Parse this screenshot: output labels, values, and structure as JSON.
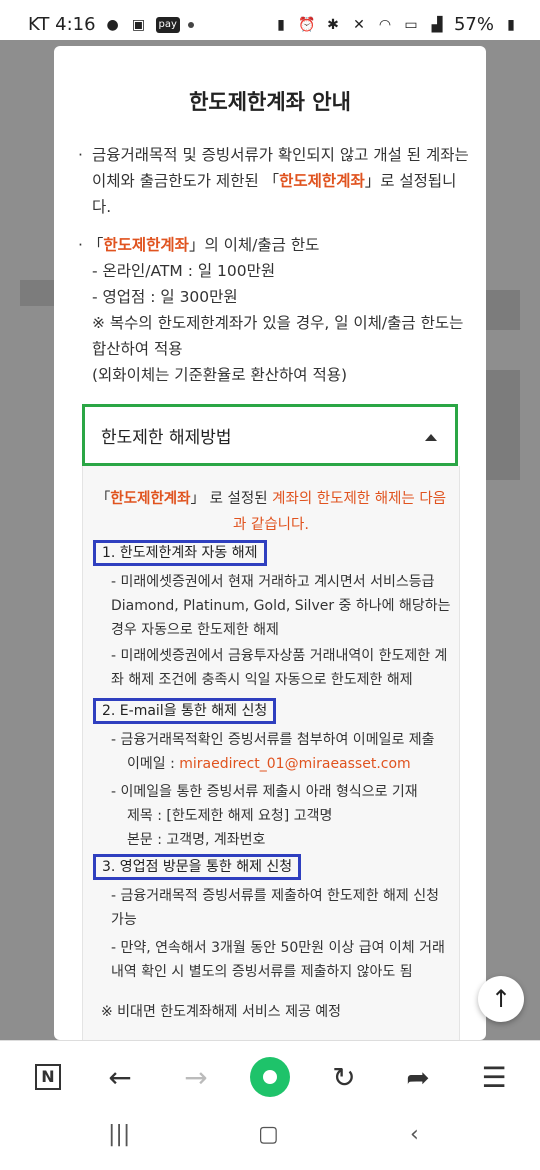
{
  "status": {
    "carrier_time": "KT 4:16",
    "pay": "pay",
    "battery": "57%"
  },
  "modal": {
    "title": "한도제한계좌 안내",
    "intro_pre": "금융거래목적 및 증빙서류가 확인되지 않고 개설 된 계좌는 이체와 출금한도가 제한된 「",
    "intro_highlight": "한도제한계좌",
    "intro_post": "」로 설정됩니다.",
    "limits_pre": "「",
    "limits_highlight": "한도제한계좌",
    "limits_post": "」의 이체/출금 한도",
    "limit_online": "- 온라인/ATM : 일 100만원",
    "limit_branch": "- 영업점 : 일 300만원",
    "limit_note1": "※ 복수의 한도제한계좌가 있을 경우, 일 이체/출금 한도는 합산하여 적용",
    "limit_note2": "(외화이체는 기준환율로 환산하여 적용)",
    "accordion_title": "한도제한 해제방법",
    "lead_pre": "「",
    "lead_highlight": "한도제한계좌",
    "lead_mid": "」 로 설정된 ",
    "lead_orange": "계좌의 한도제한 해제는 다음과 같습니다.",
    "sec1_title": "1. 한도제한계좌 자동 해제",
    "sec1_a": "- 미래에셋증권에서 현재 거래하고 계시면서 서비스등급 Diamond, Platinum, Gold, Silver 중 하나에 해당하는 경우 자동으로 한도제한 해제",
    "sec1_b": "- 미래에셋증권에서 금융투자상품 거래내역이 한도제한 계좌 해제 조건에 충족시 익일 자동으로 한도제한 해제",
    "sec2_title": "2. E-mail을 통한 해제 신청",
    "sec2_a": "- 금융거래목적확인 증빙서류를 첨부하여 이메일로 제출",
    "sec2_mail_label": "이메일 : ",
    "sec2_mail": "miraedirect_01@miraeasset.com",
    "sec2_b": "- 이메일을 통한 증빙서류 제출시 아래 형식으로 기재",
    "sec2_subject": "제목 : [한도제한 해제 요청] 고객명",
    "sec2_body": "본문 : 고객명, 계좌번호",
    "sec3_title": "3. 영업점 방문을 통한 해제 신청",
    "sec3_a": "- 금융거래목적 증빙서류를 제출하여 한도제한 해제 신청 가능",
    "sec3_b": "- 만약, 연속해서 3개월 동안 50만원 이상 급여 이체 거래 내역 확인 시 별도의 증빙서류를 제출하지 않아도 됨",
    "footnote": "※ 비대면 한도계좌해제 서비스 제공 예정"
  },
  "toolbar": {
    "n_label": "N"
  }
}
